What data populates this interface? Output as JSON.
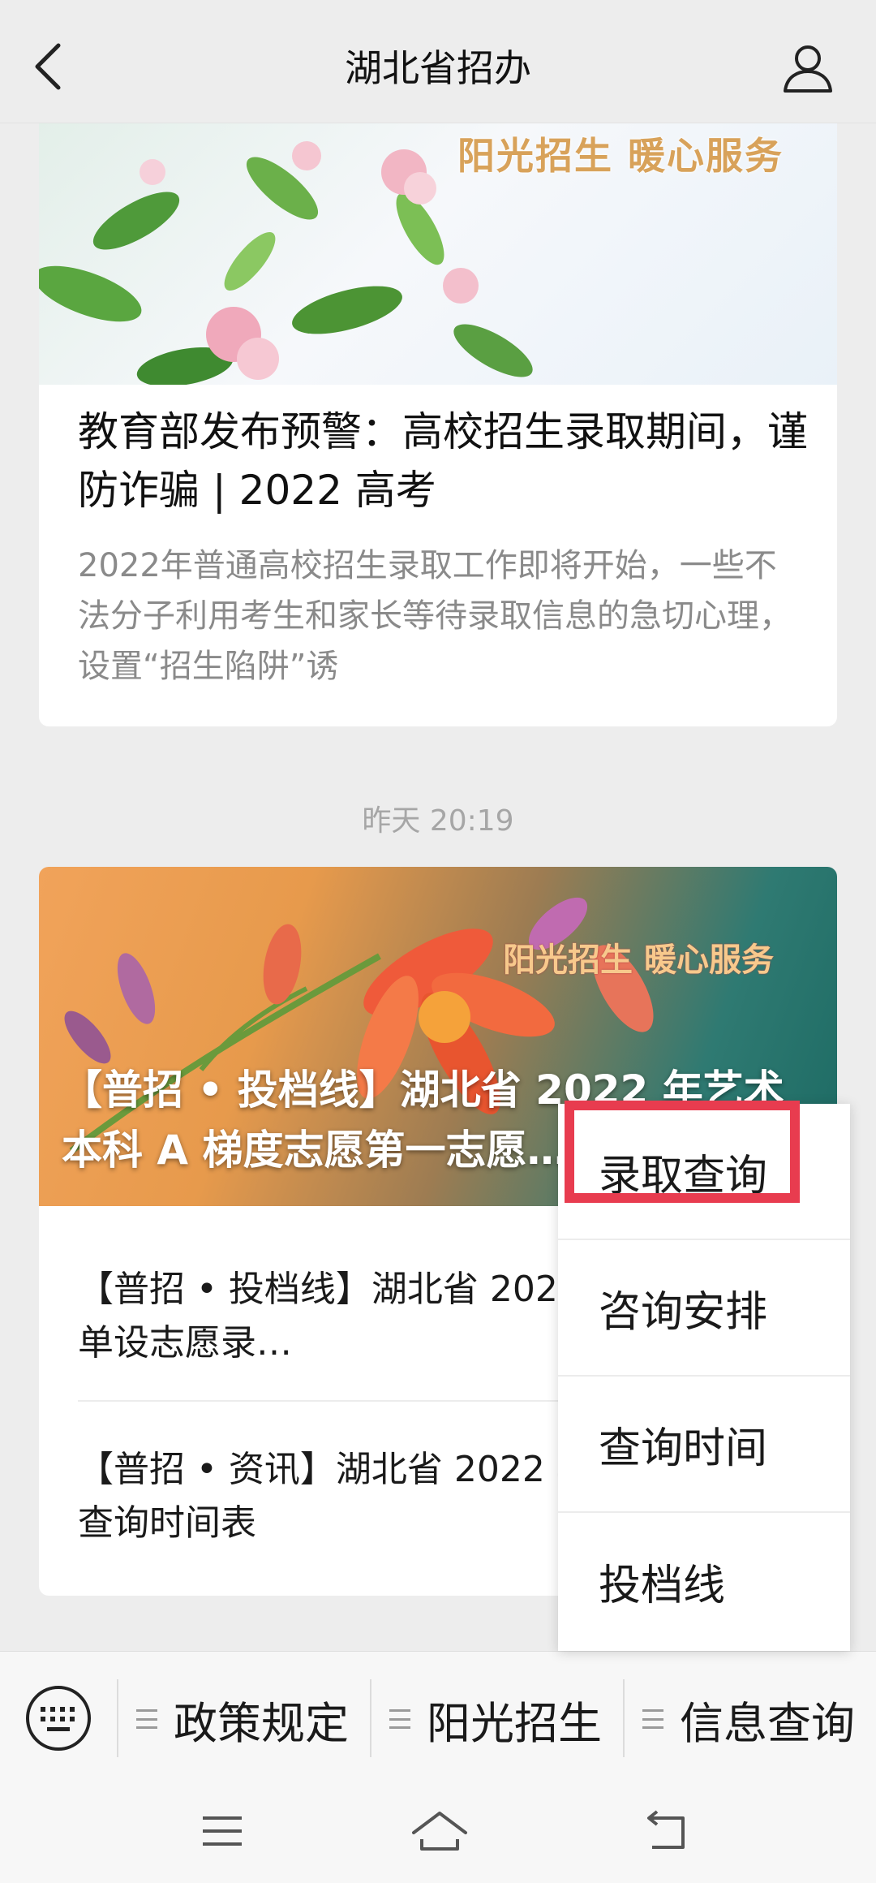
{
  "header": {
    "title": "湖北省招办",
    "back_icon": "chevron-left-icon",
    "profile_icon": "user-icon"
  },
  "article1": {
    "banner_slogan": "阳光招生 暖心服务",
    "title": "教育部发布预警：高校招生录取期间，谨防诈骗 | 2022 高考",
    "description": "2022年普通高校招生录取工作即将开始，一些不法分子利用考生和家长等待录取信息的急切心理，设置“招生陷阱”诱"
  },
  "timestamp": "昨天 20:19",
  "article2": {
    "banner_slogan": "阳光招生 暖心服务",
    "main_title": "【普招 • 投档线】湖北省 2022 年艺术本科 A 梯度志愿第一志愿…",
    "items": [
      {
        "text": "【普招 • 投档线】湖北省 2022 年本科提前批单设志愿录…"
      },
      {
        "text": "【普招 • 资讯】湖北省 2022 年考生录取状态查询时间表"
      }
    ]
  },
  "popup_menu": {
    "items": [
      {
        "label": "录取查询",
        "highlighted": true
      },
      {
        "label": "咨询安排"
      },
      {
        "label": "查询时间"
      },
      {
        "label": "投档线"
      }
    ],
    "highlight_color": "#e83c4f"
  },
  "bottom_menu": {
    "keyboard_icon": "keyboard-icon",
    "tabs": [
      {
        "label": "政策规定"
      },
      {
        "label": "阳光招生"
      },
      {
        "label": "信息查询"
      }
    ]
  },
  "system_nav": {
    "buttons": [
      "menu-icon",
      "home-icon",
      "back-icon"
    ]
  }
}
